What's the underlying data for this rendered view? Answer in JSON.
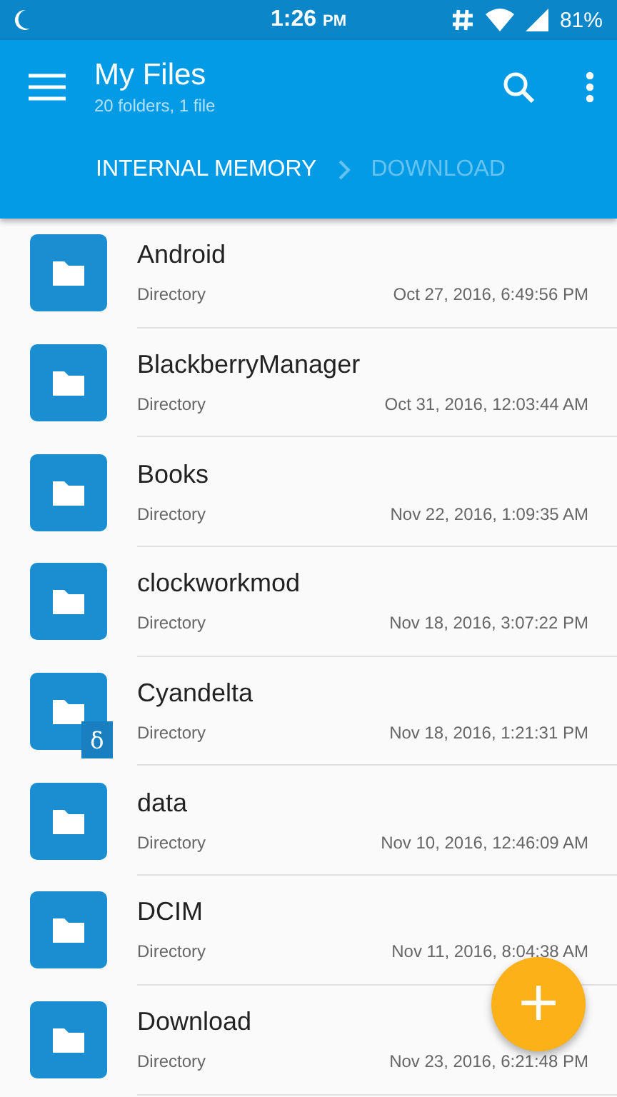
{
  "status_bar": {
    "time": "1:26",
    "ampm": "PM",
    "battery": "81%"
  },
  "app_bar": {
    "title": "My Files",
    "subtitle": "20 folders, 1 file"
  },
  "breadcrumbs": [
    {
      "label": "INTERNAL MEMORY",
      "selected": true
    },
    {
      "label": "DOWNLOAD",
      "selected": false
    }
  ],
  "files": [
    {
      "name": "Android",
      "type": "Directory",
      "modified": "Oct 27, 2016, 6:49:56 PM"
    },
    {
      "name": "BlackberryManager",
      "type": "Directory",
      "modified": "Oct 31, 2016, 12:03:44 AM"
    },
    {
      "name": "Books",
      "type": "Directory",
      "modified": "Nov 22, 2016, 1:09:35 AM"
    },
    {
      "name": "clockworkmod",
      "type": "Directory",
      "modified": "Nov 18, 2016, 3:07:22 PM"
    },
    {
      "name": "Cyandelta",
      "type": "Directory",
      "modified": "Nov 18, 2016, 1:21:31 PM",
      "badge": "δ"
    },
    {
      "name": "data",
      "type": "Directory",
      "modified": "Nov 10, 2016, 12:46:09 AM"
    },
    {
      "name": "DCIM",
      "type": "Directory",
      "modified": "Nov 11, 2016, 8:04:38 AM"
    },
    {
      "name": "Download",
      "type": "Directory",
      "modified": "Nov 23, 2016, 6:21:48 PM"
    }
  ],
  "fab": {
    "label": "+"
  }
}
